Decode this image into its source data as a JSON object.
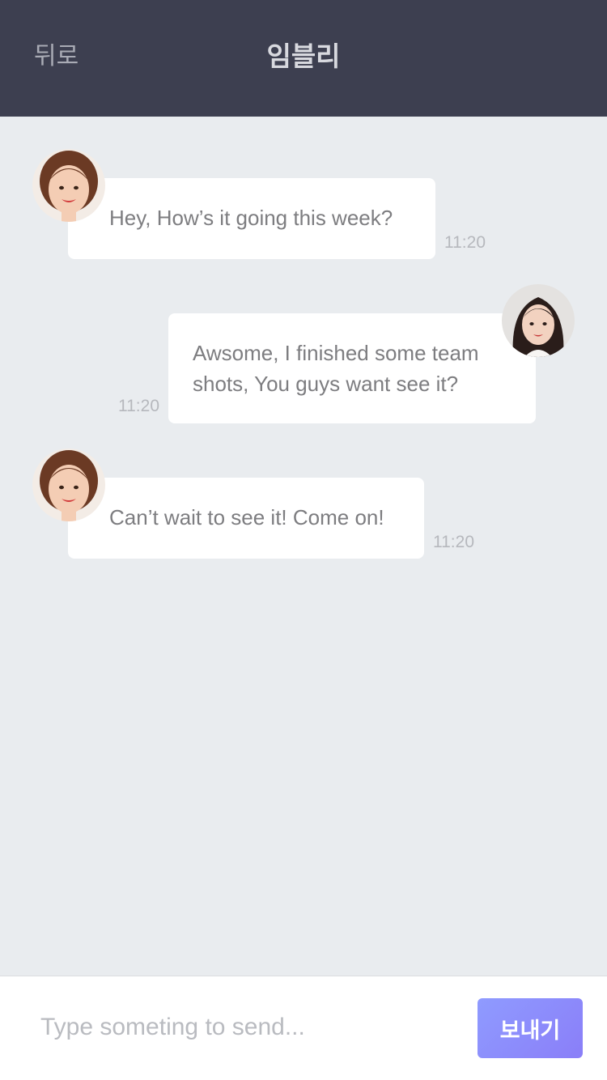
{
  "header": {
    "back_label": "뒤로",
    "title": "임블리"
  },
  "messages": [
    {
      "sender": "other",
      "text": "Hey, How’s it going this week?",
      "time": "11:20"
    },
    {
      "sender": "me",
      "lines": [
        "Awsome, I finished some team",
        "shots, You guys want see it?"
      ],
      "time": "11:20"
    },
    {
      "sender": "other",
      "text": "Can’t wait to see it! Come on!",
      "time": "11:20"
    }
  ],
  "composer": {
    "placeholder": "Type someting to send...",
    "value": "",
    "send_label": "보내기"
  },
  "colors": {
    "header_bg": "#3d3f50",
    "chat_bg": "#e9ecef",
    "bubble_bg": "#ffffff",
    "send_gradient_start": "#8f9bff",
    "send_gradient_end": "#8a7ef8"
  },
  "icons": {
    "other_avatar": "avatar-photo-woman-short-hair",
    "my_avatar": "avatar-photo-woman-long-hair"
  }
}
